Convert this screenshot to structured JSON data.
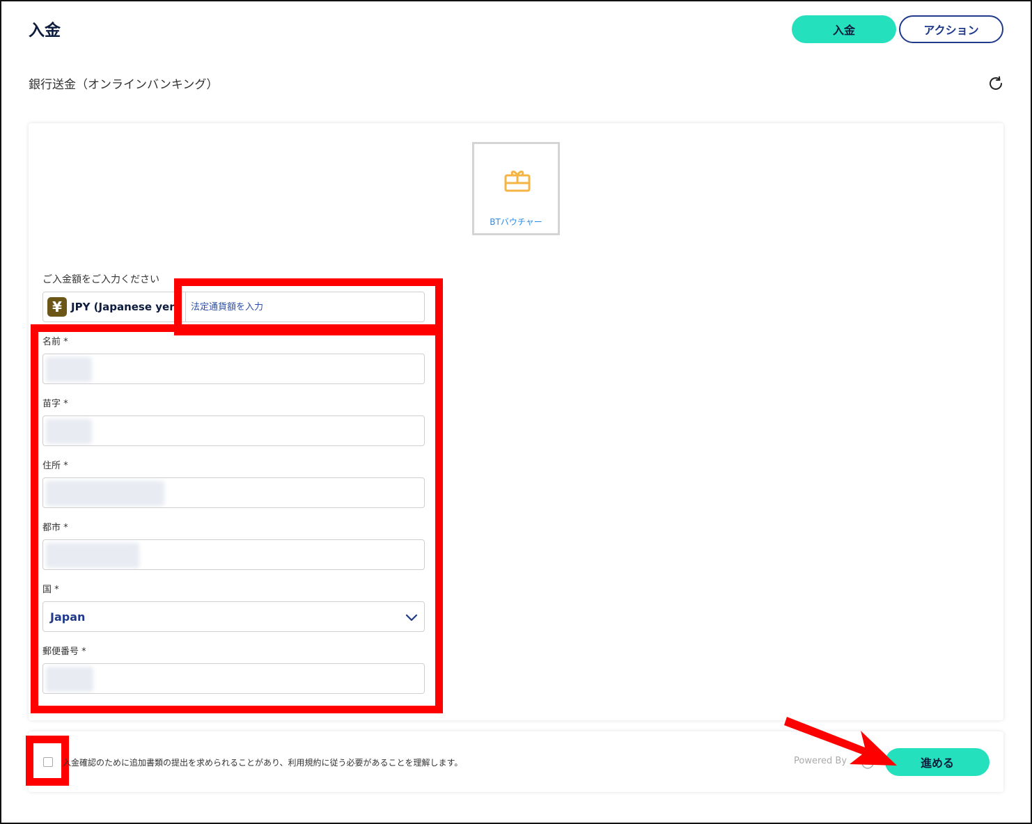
{
  "header": {
    "title": "入金",
    "deposit_button": "入金",
    "action_button": "アクション"
  },
  "method": {
    "subtitle": "銀行送金（オンラインバンキング）",
    "voucher_label": "BTバウチャー"
  },
  "amount": {
    "label": "ご入金額をご入力ください",
    "currency_symbol": "¥",
    "currency": "JPY (Japanese yen)",
    "placeholder": "法定通貨額を入力"
  },
  "form": {
    "first_name_label": "名前 *",
    "last_name_label": "苗字 *",
    "address_label": "住所 *",
    "city_label": "都市 *",
    "country_label": "国 *",
    "country_value": "Japan",
    "postal_code_label": "郵便番号 *"
  },
  "footer": {
    "consent_text": "入金確認のために追加書類の提出を求められることがあり、利用規約に従う必要があることを理解します。",
    "powered_by": "Powered By",
    "proceed_button": "進める"
  },
  "colors": {
    "accent": "#24e0bc",
    "primary": "#1f3a8a",
    "highlight": "#ff0000",
    "voucher_icon": "#f5b545"
  }
}
